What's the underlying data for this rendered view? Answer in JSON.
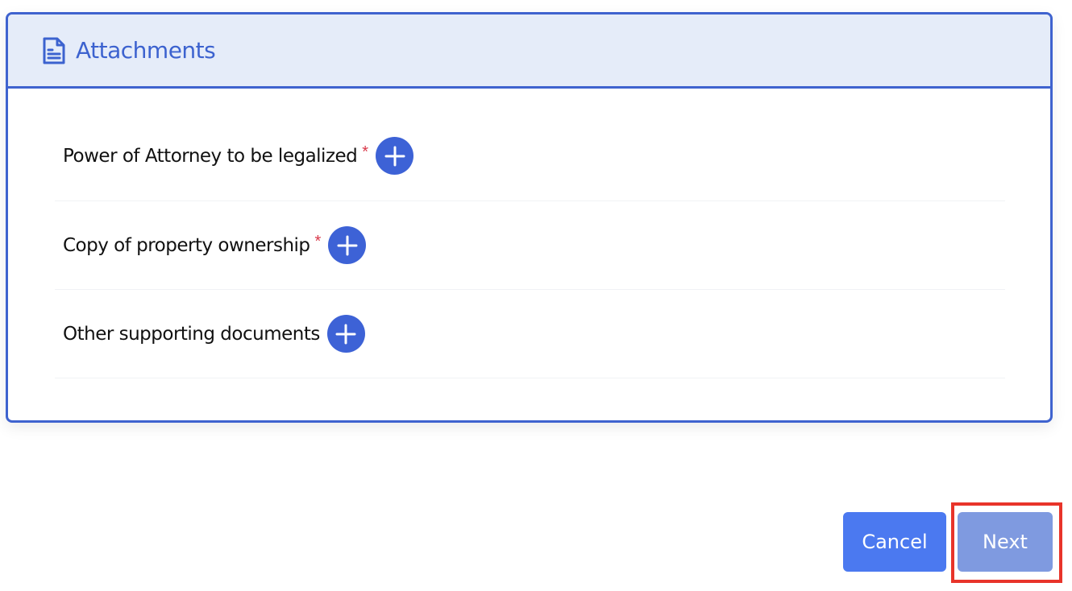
{
  "attachments": {
    "title": "Attachments",
    "icon": "document-icon",
    "items": [
      {
        "label": "Power of Attorney to be legalized",
        "required_mark": "*"
      },
      {
        "label": "Copy of property ownership",
        "required_mark": "*"
      },
      {
        "label": "Other supporting documents",
        "required_mark": ""
      }
    ]
  },
  "actions": {
    "cancel_label": "Cancel",
    "next_label": "Next"
  },
  "colors": {
    "accent": "#3f63cf",
    "header_bg": "#e5ecf9",
    "required": "#d9394a",
    "cancel_bg": "#4b79f0",
    "next_bg_disabled": "#7f9ae0",
    "highlight": "#e8342a"
  }
}
